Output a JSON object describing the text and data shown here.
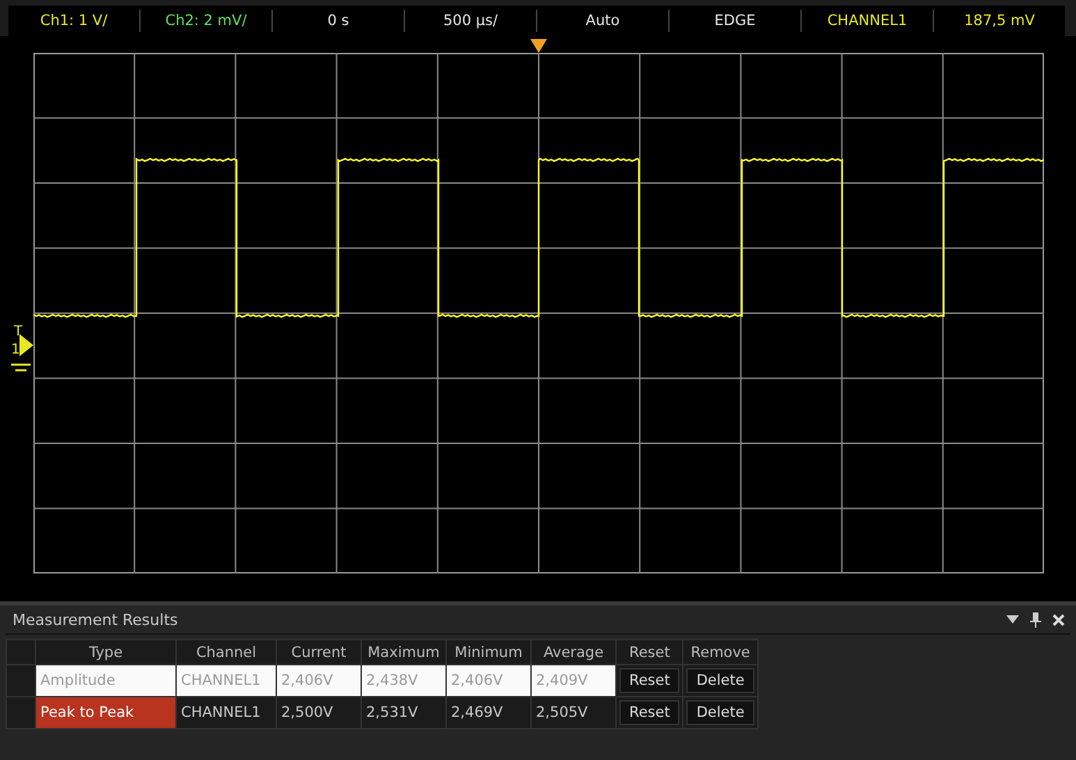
{
  "status_bar": [
    {
      "kind": "ch1",
      "text": "Ch1: 1 V/"
    },
    {
      "kind": "ch2",
      "text": "Ch2: 2 mV/"
    },
    {
      "kind": "plain",
      "text": "0 s"
    },
    {
      "kind": "plain",
      "text": "500 µs/"
    },
    {
      "kind": "plain",
      "text": "Auto"
    },
    {
      "kind": "plain",
      "text": "EDGE"
    },
    {
      "kind": "ch1",
      "text": "CHANNEL1"
    },
    {
      "kind": "ch1",
      "text": "187,5 mV"
    }
  ],
  "trigger_marker": {
    "label": "T",
    "channel": "1"
  },
  "panel": {
    "title": "Measurement Results",
    "columns": [
      "Type",
      "Channel",
      "Current",
      "Maximum",
      "Minimum",
      "Average",
      "Reset",
      "Remove"
    ],
    "rows": [
      {
        "selected": true,
        "type": "Amplitude",
        "channel": "CHANNEL1",
        "current": "2,406V",
        "maximum": "2,438V",
        "minimum": "2,406V",
        "average": "2,409V",
        "reset": "Reset",
        "remove": "Delete"
      },
      {
        "selected": false,
        "color": "#b8341f",
        "type": "Peak to Peak",
        "channel": "CHANNEL1",
        "current": "2,500V",
        "maximum": "2,531V",
        "minimum": "2,469V",
        "average": "2,505V",
        "reset": "Reset",
        "remove": "Delete"
      }
    ]
  }
}
